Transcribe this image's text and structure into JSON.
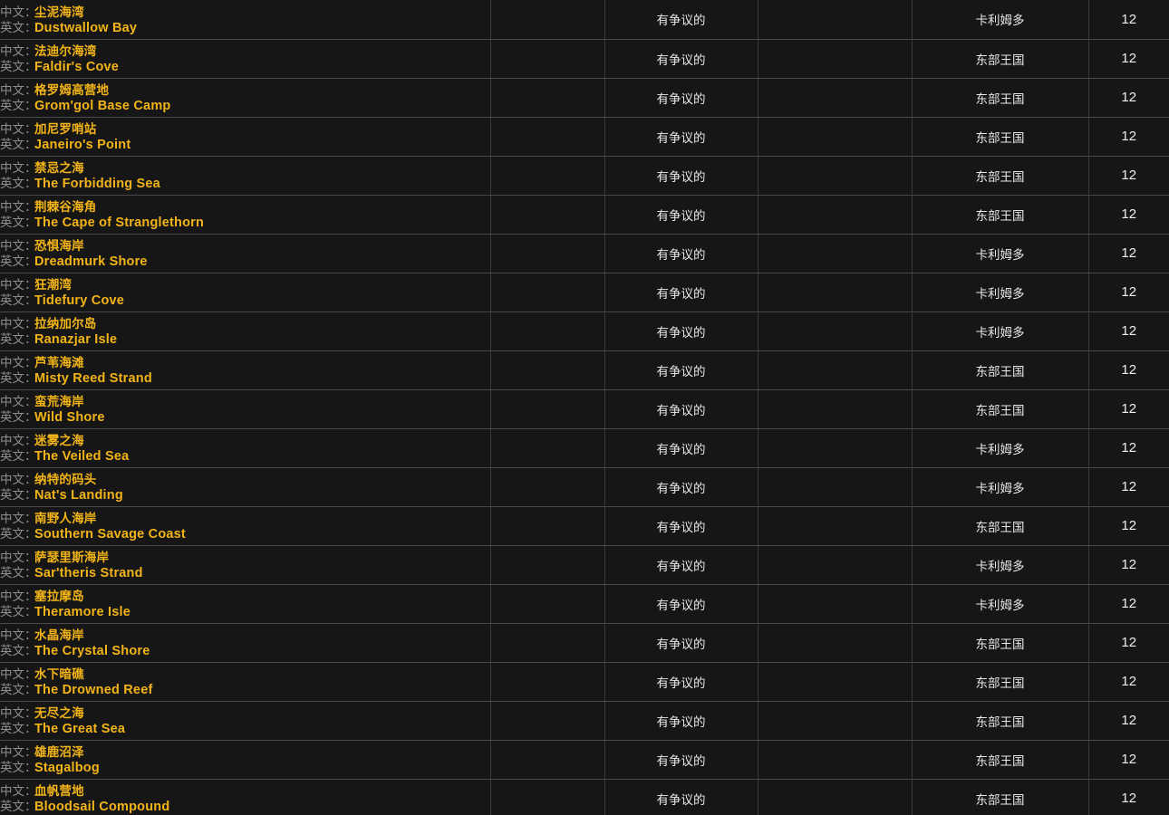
{
  "labels": {
    "cn_label": "中文：",
    "en_label": "英文："
  },
  "colors": {
    "background": "#131313",
    "row_background": "#161616",
    "name_accent": "#f2b418",
    "label_muted": "#8e8e8e",
    "row_divider": "#4a4a4a",
    "column_divider": "#3a3a3a",
    "body_text": "#e8e8e8"
  },
  "columns": [
    {
      "key": "name",
      "name": "zone-name"
    },
    {
      "key": "blank1",
      "name": "blank-column-1"
    },
    {
      "key": "status",
      "name": "zone-status"
    },
    {
      "key": "blank2",
      "name": "blank-column-2"
    },
    {
      "key": "continent",
      "name": "continent"
    },
    {
      "key": "level",
      "name": "level"
    }
  ],
  "rows": [
    {
      "cn": "尘泥海湾",
      "en": "Dustwallow Bay",
      "blank1": "",
      "status": "有争议的",
      "blank2": "",
      "continent": "卡利姆多",
      "level": "12"
    },
    {
      "cn": "法迪尔海湾",
      "en": "Faldir's Cove",
      "blank1": "",
      "status": "有争议的",
      "blank2": "",
      "continent": "东部王国",
      "level": "12"
    },
    {
      "cn": "格罗姆高营地",
      "en": "Grom'gol Base Camp",
      "blank1": "",
      "status": "有争议的",
      "blank2": "",
      "continent": "东部王国",
      "level": "12"
    },
    {
      "cn": "加尼罗哨站",
      "en": "Janeiro's Point",
      "blank1": "",
      "status": "有争议的",
      "blank2": "",
      "continent": "东部王国",
      "level": "12"
    },
    {
      "cn": "禁忌之海",
      "en": "The Forbidding Sea",
      "blank1": "",
      "status": "有争议的",
      "blank2": "",
      "continent": "东部王国",
      "level": "12"
    },
    {
      "cn": "荆棘谷海角",
      "en": "The Cape of Stranglethorn",
      "blank1": "",
      "status": "有争议的",
      "blank2": "",
      "continent": "东部王国",
      "level": "12"
    },
    {
      "cn": "恐惧海岸",
      "en": "Dreadmurk Shore",
      "blank1": "",
      "status": "有争议的",
      "blank2": "",
      "continent": "卡利姆多",
      "level": "12"
    },
    {
      "cn": "狂潮湾",
      "en": "Tidefury Cove",
      "blank1": "",
      "status": "有争议的",
      "blank2": "",
      "continent": "卡利姆多",
      "level": "12"
    },
    {
      "cn": "拉纳加尔岛",
      "en": "Ranazjar Isle",
      "blank1": "",
      "status": "有争议的",
      "blank2": "",
      "continent": "卡利姆多",
      "level": "12"
    },
    {
      "cn": "芦苇海滩",
      "en": "Misty Reed Strand",
      "blank1": "",
      "status": "有争议的",
      "blank2": "",
      "continent": "东部王国",
      "level": "12"
    },
    {
      "cn": "蛮荒海岸",
      "en": "Wild Shore",
      "blank1": "",
      "status": "有争议的",
      "blank2": "",
      "continent": "东部王国",
      "level": "12"
    },
    {
      "cn": "迷雾之海",
      "en": "The Veiled Sea",
      "blank1": "",
      "status": "有争议的",
      "blank2": "",
      "continent": "卡利姆多",
      "level": "12"
    },
    {
      "cn": "纳特的码头",
      "en": "Nat's Landing",
      "blank1": "",
      "status": "有争议的",
      "blank2": "",
      "continent": "卡利姆多",
      "level": "12"
    },
    {
      "cn": "南野人海岸",
      "en": "Southern Savage Coast",
      "blank1": "",
      "status": "有争议的",
      "blank2": "",
      "continent": "东部王国",
      "level": "12"
    },
    {
      "cn": "萨瑟里斯海岸",
      "en": "Sar'theris Strand",
      "blank1": "",
      "status": "有争议的",
      "blank2": "",
      "continent": "卡利姆多",
      "level": "12"
    },
    {
      "cn": "塞拉摩岛",
      "en": "Theramore Isle",
      "blank1": "",
      "status": "有争议的",
      "blank2": "",
      "continent": "卡利姆多",
      "level": "12"
    },
    {
      "cn": "水晶海岸",
      "en": "The Crystal Shore",
      "blank1": "",
      "status": "有争议的",
      "blank2": "",
      "continent": "东部王国",
      "level": "12"
    },
    {
      "cn": "水下暗礁",
      "en": "The Drowned Reef",
      "blank1": "",
      "status": "有争议的",
      "blank2": "",
      "continent": "东部王国",
      "level": "12"
    },
    {
      "cn": "无尽之海",
      "en": "The Great Sea",
      "blank1": "",
      "status": "有争议的",
      "blank2": "",
      "continent": "东部王国",
      "level": "12"
    },
    {
      "cn": "雄鹿沼泽",
      "en": "Stagalbog",
      "blank1": "",
      "status": "有争议的",
      "blank2": "",
      "continent": "东部王国",
      "level": "12"
    },
    {
      "cn": "血帆营地",
      "en": "Bloodsail Compound",
      "blank1": "",
      "status": "有争议的",
      "blank2": "",
      "continent": "东部王国",
      "level": "12"
    }
  ]
}
